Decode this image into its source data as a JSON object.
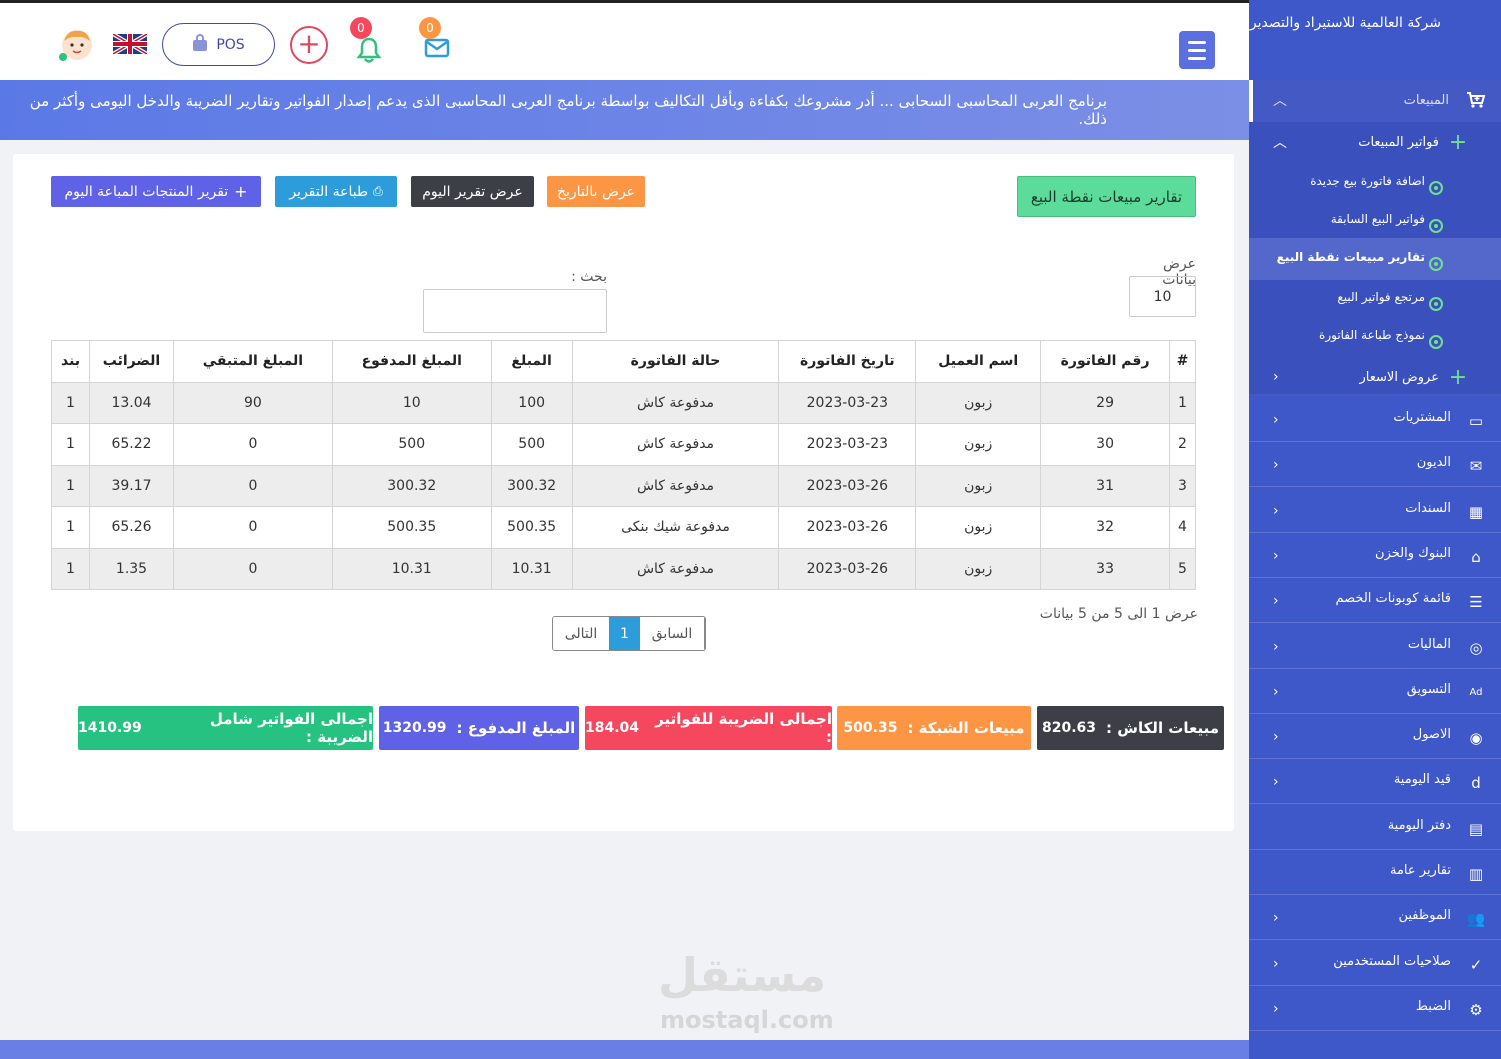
{
  "header": {
    "notifications_count": "0",
    "messages_count": "0",
    "pos_label": "POS",
    "language_flag": "uk-flag-icon"
  },
  "banner": {
    "text": "برنامج العربى المحاسبى السحابى ... أدر مشروعك بكفاءة وبأقل التكاليف بواسطة برنامج العربى المحاسبى الذى يدعم إصدار الفواتير وتقارير الضريبة والدخل اليومى وأكثر من ذلك."
  },
  "page": {
    "title_button": "تقارير مبيعات نقطة البيع",
    "btn_by_date": "عرض بالتاريخ",
    "btn_today": "عرض تقرير اليوم",
    "btn_print": "طباعة التقرير",
    "btn_products": "تقرير المنتجات المباعة اليوم",
    "show_label": "عرض بيانات",
    "show_value": "10",
    "search_label": "بحث :",
    "info_text": "عرض 1 الى 5 من 5 بيانات",
    "prev": "السابق",
    "page": "1",
    "next": "التالى"
  },
  "table": {
    "headers": [
      "#",
      "رقم الفاتورة",
      "اسم العميل",
      "تاريخ الفاتورة",
      "حالة الفاتورة",
      "المبلغ",
      "المبلغ المدفوع",
      "المبلغ المتبقي",
      "الضرائب",
      "بند"
    ],
    "rows": [
      [
        "1",
        "29",
        "زبون",
        "2023-03-23",
        "مدفوعة كاش",
        "100",
        "10",
        "90",
        "13.04",
        "1"
      ],
      [
        "2",
        "30",
        "زبون",
        "2023-03-23",
        "مدفوعة كاش",
        "500",
        "500",
        "0",
        "65.22",
        "1"
      ],
      [
        "3",
        "31",
        "زبون",
        "2023-03-26",
        "مدفوعة كاش",
        "300.32",
        "300.32",
        "0",
        "39.17",
        "1"
      ],
      [
        "4",
        "32",
        "زبون",
        "2023-03-26",
        "مدفوعة شيك بنكى",
        "500.35",
        "500.35",
        "0",
        "65.26",
        "1"
      ],
      [
        "5",
        "33",
        "زبون",
        "2023-03-26",
        "مدفوعة كاش",
        "10.31",
        "10.31",
        "0",
        "1.35",
        "1"
      ]
    ]
  },
  "totals": {
    "cash_label": "مبيعات الكاش :",
    "cash_value": "820.63",
    "network_label": "مبيعات الشبكة :",
    "network_value": "500.35",
    "tax_label": "اجمالى الضريبة للفواتير :",
    "tax_value": "184.04",
    "paid_label": "المبلغ المدفوع :",
    "paid_value": "1320.99",
    "grand_label": "اجمالى الفواتير شامل الضريبة :",
    "grand_value": "1410.99"
  },
  "sidebar": {
    "company": "شركة العالمية للاستيراد والتصدير",
    "sales": "المبيعات",
    "sales_invoices": "فواتير المبيعات",
    "sub_items": [
      "اضافة فاتورة بيع جديدة",
      "فواتير البيع السابقة",
      "تقارير مبيعات نقطة البيع",
      "مرتجع فواتير البيع",
      "نموذج طباعة الفاتورة"
    ],
    "quotes": "عروض الاسعار",
    "items": [
      "المشتريات",
      "الديون",
      "السندات",
      "البنوك والخزن",
      "قائمة كوبونات الخصم",
      "الماليات",
      "التسويق",
      "الاصول",
      "قيد اليومية",
      "دفتر اليومية",
      "تقارير عامة",
      "الموظفين",
      "صلاحيات المستخدمين",
      "الضبط"
    ]
  },
  "watermark": {
    "arabic": "مستقل",
    "latin": "mostaql.com"
  },
  "colors": {
    "primary": "#3e57c9",
    "green": "#5bdc9a",
    "orange": "#fd9644",
    "dark": "#3d3f46",
    "blue": "#2d9cdb",
    "purple": "#5f61e6",
    "red": "#f5485e",
    "teal": "#26c281"
  }
}
